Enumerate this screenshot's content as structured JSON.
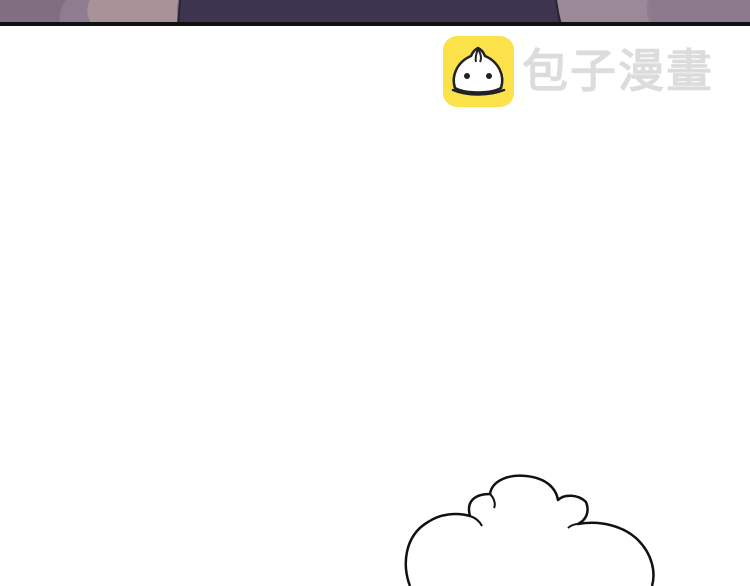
{
  "watermark": {
    "brand_name": "包子漫畫",
    "logo_icon": "steamed-bun-icon",
    "logo_color": "#fbe14a",
    "text_color": "#dcdcdc"
  },
  "top_panel": {
    "border_color": "#111111",
    "background_color": "#8e7d8e",
    "dark_shape_color": "#3d3450"
  },
  "speech_bubble": {
    "icon": "thought-cloud-icon",
    "text": ""
  }
}
